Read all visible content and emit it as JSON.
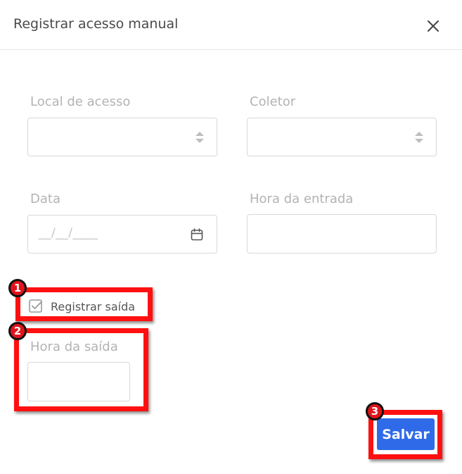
{
  "modal": {
    "title": "Registrar acesso manual",
    "close_icon": "close-icon"
  },
  "form": {
    "local_acesso": {
      "label": "Local de acesso",
      "value": ""
    },
    "coletor": {
      "label": "Coletor",
      "value": ""
    },
    "data": {
      "label": "Data",
      "placeholder": "__/__/____"
    },
    "hora_entrada": {
      "label": "Hora da entrada",
      "value": ""
    },
    "registrar_saida": {
      "label": "Registrar saída",
      "checked": true
    },
    "hora_saida": {
      "label": "Hora da saída",
      "value": ""
    }
  },
  "actions": {
    "save_label": "Salvar"
  },
  "annotations": [
    {
      "number": "1"
    },
    {
      "number": "2"
    },
    {
      "number": "3"
    }
  ],
  "colors": {
    "primary": "#2f6be8",
    "annotation": "#ff1010"
  }
}
